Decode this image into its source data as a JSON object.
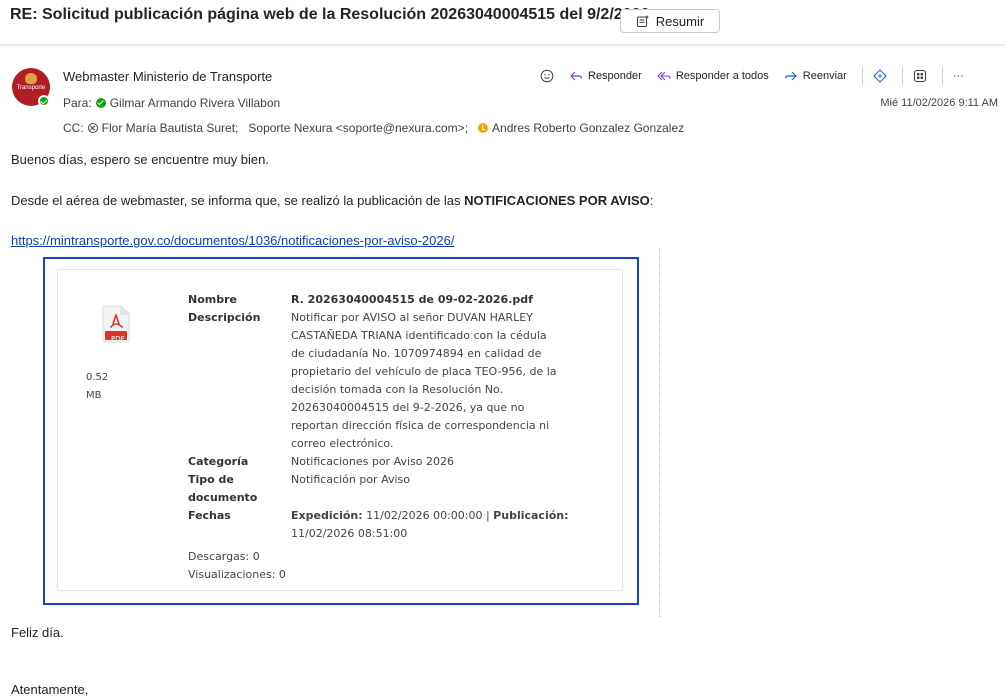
{
  "header": {
    "subject": "RE: Solicitud publicación página web de la Resolución 20263040004515 del 9/2/2026",
    "summarize_label": "Resumir"
  },
  "sender": {
    "name": "Webmaster Ministerio de Transporte",
    "avatar_text": "Transporte",
    "to_prefix": "Para:",
    "to_name": "Gilmar Armando Rivera Villabon",
    "cc_prefix": "CC:",
    "cc_1": "Flor María Bautista Suret;",
    "cc_2": "Soporte Nexura <soporte@nexura.com>;",
    "cc_3": "Andres Roberto Gonzalez Gonzalez",
    "date": "Mié 11/02/2026 9:11 AM"
  },
  "actions": {
    "reply": "Responder",
    "reply_all": "Responder a todos",
    "forward": "Reenviar",
    "more": "···"
  },
  "body": {
    "greeting": "Buenos días, espero se encuentre muy bien.",
    "intro_plain": "Desde el aérea de webmaster, se informa que, se realizó la publicación de las ",
    "intro_bold": "NOTIFICACIONES POR AVISO",
    "intro_end": ":",
    "link": "https://mintransporte.gov.co/documentos/1036/notificaciones-por-aviso-2026/",
    "closing": "Feliz día.",
    "signoff": "Atentamente,"
  },
  "document_card": {
    "pdf_label": "PDF",
    "size_value": "0.52",
    "size_unit": "MB",
    "nombre_label": "Nombre",
    "nombre_value": "R. 20263040004515 de 09-02-2026.pdf",
    "descripcion_label": "Descripción",
    "descripcion_lines": [
      "Notificar por AVISO al señor DUVAN HARLEY",
      "CASTAÑEDA TRIANA identificado con la cédula",
      "de ciudadanía No. 1070974894  en calidad de",
      "propietario del vehículo de placa TEO-956, de la",
      "decisión tomada con la Resolución No.",
      "20263040004515 del 9-2-2026, ya que no",
      "reportan dirección física de correspondencia ni",
      "correo electrónico."
    ],
    "categoria_label": "Categoría",
    "categoria_value": "Notificaciones por Aviso 2026",
    "tipo_label_1": "Tipo de",
    "tipo_label_2": "documento",
    "tipo_value": "Notificación por Aviso",
    "fechas_label": "Fechas",
    "expedicion_label": "Expedición:",
    "expedicion_value": " 11/02/2026 00:00:00 |",
    "publicacion_label": "Publicación:",
    "publicacion_value": "11/02/2026 08:51:00",
    "descargas": "Descargas: 0",
    "visualizaciones": "Visualizaciones: 0"
  },
  "colors": {
    "accent_blue": "#1842cc",
    "link": "#0f3fae",
    "pdf_red": "#d9332a",
    "presence_green": "#13a10e"
  }
}
